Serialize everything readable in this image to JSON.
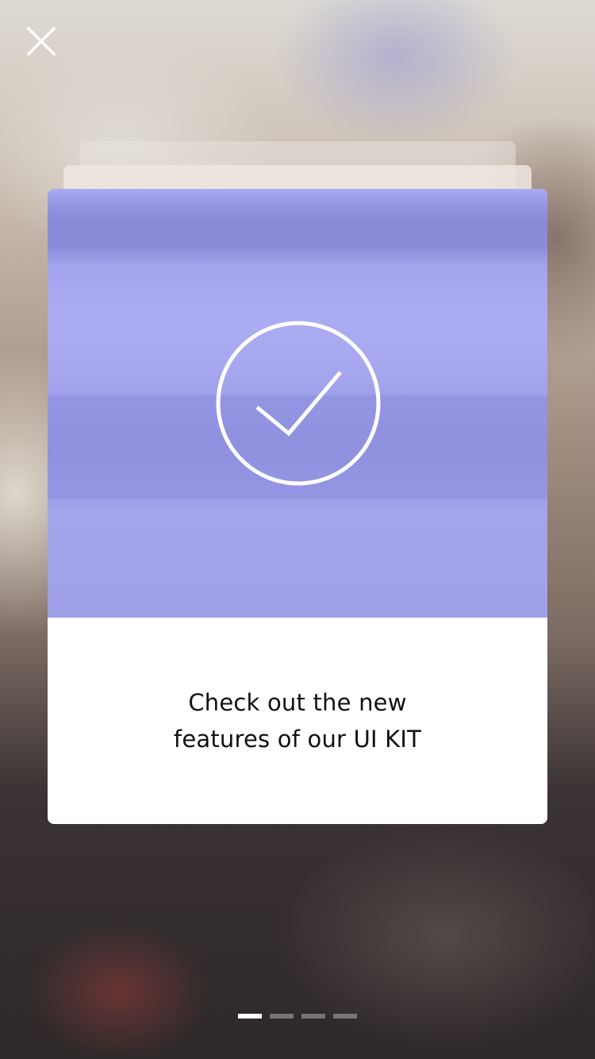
{
  "window": {
    "close_icon": "close-icon"
  },
  "card": {
    "hero_icon": "check-circle-icon",
    "caption_line_1": "Check out the new",
    "caption_line_2": "features of our UI KIT",
    "accent_color": "#a3a4ee"
  },
  "pager": {
    "total": 4,
    "active_index": 0,
    "colors": {
      "active": "#ffffff",
      "inactive": "rgba(255,255,255,0.35)"
    }
  }
}
